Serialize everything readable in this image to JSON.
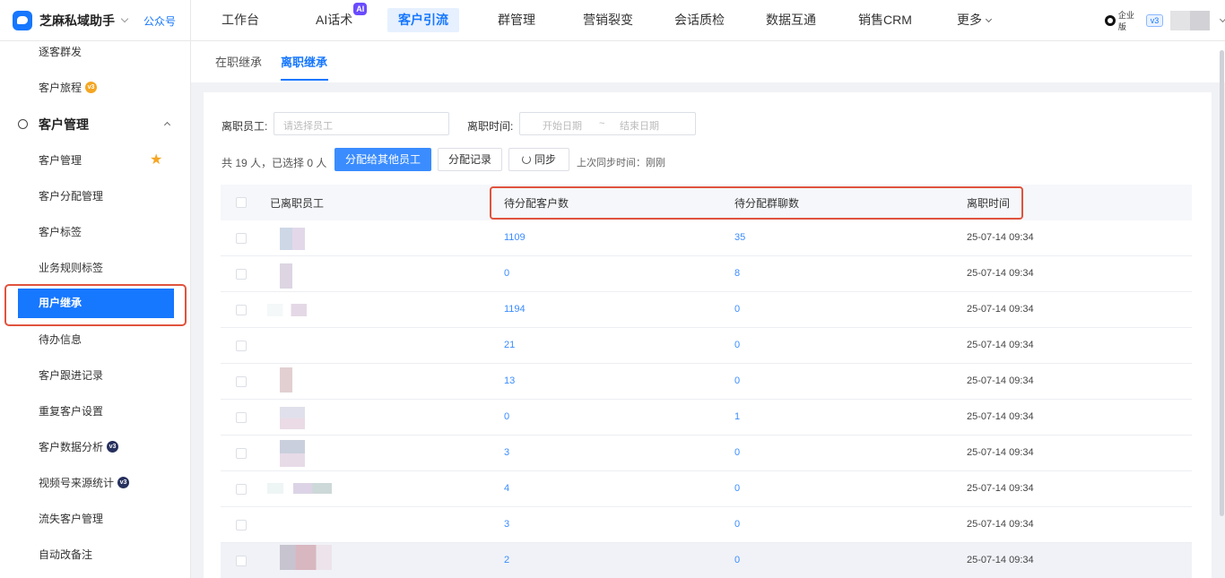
{
  "brand": {
    "name": "芝麻私域助手",
    "link": "公众号"
  },
  "nav": {
    "items": [
      "工作台",
      "AI话术",
      "客户引流",
      "群管理",
      "营销裂变",
      "会话质检",
      "数据互通",
      "销售CRM",
      "更多"
    ],
    "active": "客户引流",
    "ai_badge": "AI"
  },
  "account": {
    "edition": "企业版",
    "version": "v3"
  },
  "sidebar": {
    "items_top": [
      "逐客群发",
      "客户旅程"
    ],
    "group": "客户管理",
    "items": [
      "客户管理",
      "客户分配管理",
      "客户标签",
      "业务规则标签",
      "用户继承",
      "待办信息",
      "客户跟进记录",
      "重复客户设置",
      "客户数据分析",
      "视频号来源统计",
      "流失客户管理",
      "自动改备注"
    ],
    "active": "用户继承",
    "badge_text": "v3"
  },
  "tabs": {
    "items": [
      "在职继承",
      "离职继承"
    ],
    "active": "离职继承"
  },
  "filters": {
    "employee_label": "离职员工:",
    "employee_placeholder": "请选择员工",
    "time_label": "离职时间:",
    "start_placeholder": "开始日期",
    "separator": "~",
    "end_placeholder": "结束日期"
  },
  "toolbar": {
    "summary": "共 19 人，已选择 0 人",
    "assign_button": "分配给其他员工",
    "records_button": "分配记录",
    "sync_button": "同步",
    "last_sync": "上次同步时间：刚刚"
  },
  "table": {
    "headers": [
      "已离职员工",
      "待分配客户数",
      "待分配群聊数",
      "离职时间"
    ],
    "rows": [
      {
        "customers": "1109",
        "groups": "35",
        "time": "25-07-14 09:34"
      },
      {
        "customers": "0",
        "groups": "8",
        "time": "25-07-14 09:34"
      },
      {
        "customers": "1194",
        "groups": "0",
        "time": "25-07-14 09:34"
      },
      {
        "customers": "21",
        "groups": "0",
        "time": "25-07-14 09:34"
      },
      {
        "customers": "13",
        "groups": "0",
        "time": "25-07-14 09:34"
      },
      {
        "customers": "0",
        "groups": "1",
        "time": "25-07-14 09:34"
      },
      {
        "customers": "3",
        "groups": "0",
        "time": "25-07-14 09:34"
      },
      {
        "customers": "4",
        "groups": "0",
        "time": "25-07-14 09:34"
      },
      {
        "customers": "3",
        "groups": "0",
        "time": "25-07-14 09:34"
      },
      {
        "customers": "2",
        "groups": "0",
        "time": "25-07-14 09:34"
      }
    ]
  },
  "colors": {
    "primary": "#1677ff",
    "highlight": "#e0533e",
    "badge_orange": "#f5a623",
    "badge_navy": "#27315e"
  }
}
